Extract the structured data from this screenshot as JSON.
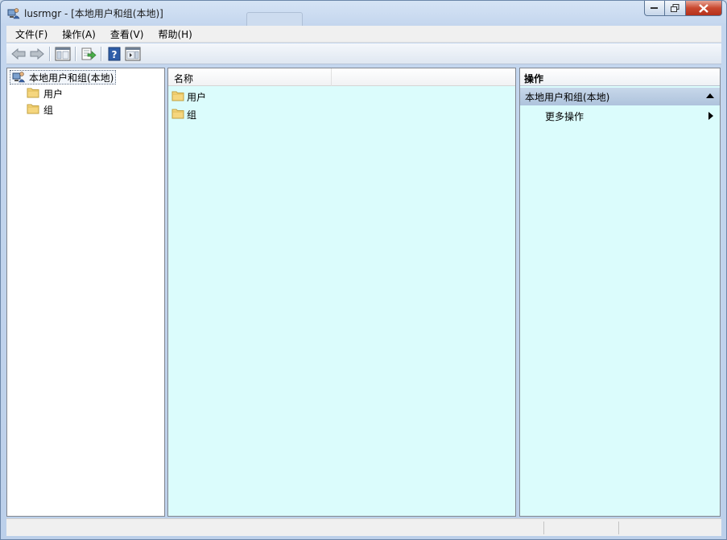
{
  "window": {
    "title": "lusrmgr - [本地用户和组(本地)]"
  },
  "icons": {
    "app": "users-computer-icon",
    "back": "arrow-left-icon",
    "forward": "arrow-right-icon",
    "console_tree": "show-hide-tree-icon",
    "export": "export-list-icon",
    "help": "help-icon",
    "action_pane": "show-hide-action-pane-icon",
    "folder": "folder-icon"
  },
  "colors": {
    "pane_background": "#dbfcfc",
    "section_header": "#aec3dc",
    "close_button": "#c9482f"
  },
  "menubar": {
    "items": [
      {
        "label": "文件(F)"
      },
      {
        "label": "操作(A)"
      },
      {
        "label": "查看(V)"
      },
      {
        "label": "帮助(H)"
      }
    ]
  },
  "tree": {
    "root": "本地用户和组(本地)",
    "children": [
      {
        "label": "用户"
      },
      {
        "label": "组"
      }
    ]
  },
  "list": {
    "columns": [
      {
        "label": "名称"
      },
      {
        "label": ""
      }
    ],
    "rows": [
      {
        "name": "用户"
      },
      {
        "name": "组"
      }
    ]
  },
  "actions": {
    "title": "操作",
    "section": "本地用户和组(本地)",
    "items": [
      {
        "label": "更多操作"
      }
    ]
  }
}
